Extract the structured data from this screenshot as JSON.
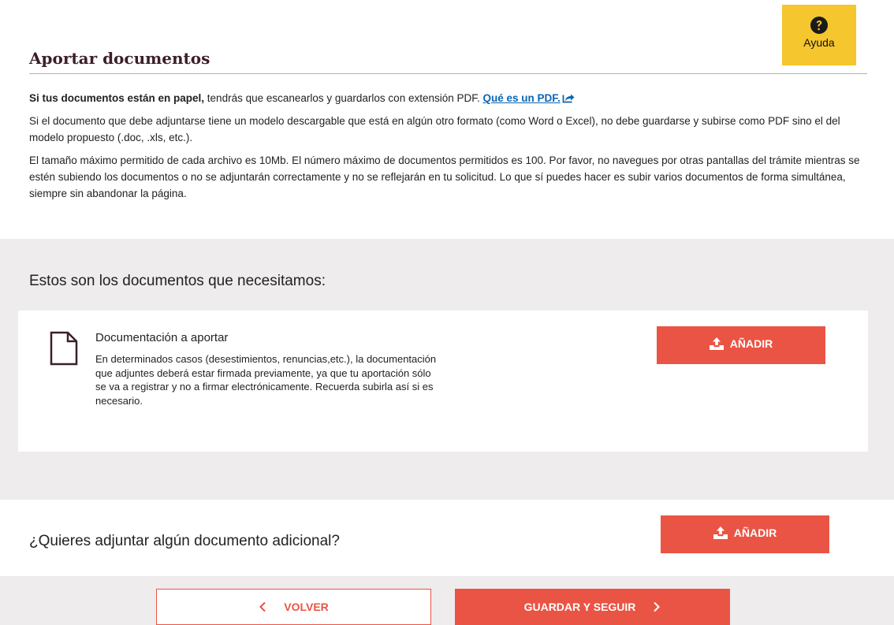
{
  "header": {
    "title": "Aportar documentos",
    "help_label": "Ayuda"
  },
  "intro": {
    "p1_strong": "Si tus documentos están en papel,",
    "p1_text": " tendrás que escanearlos y guardarlos con extensión PDF. ",
    "p1_link": "Qué es un PDF.",
    "p2": "Si el documento que debe adjuntarse tiene un modelo descargable que está en algún otro formato (como Word o Excel), no debe guardarse y subirse como PDF sino el del modelo propuesto (.doc, .xls, etc.).",
    "p3": "El tamaño máximo permitido de cada archivo es 10Mb. El número máximo de documentos permitidos es 100. Por favor, no navegues por otras pantallas del trámite mientras se estén subiendo los documentos o no se adjuntarán correctamente y no se reflejarán en tu solicitud. Lo que sí puedes hacer es subir varios documentos de forma simultánea, siempre sin abandonar la página."
  },
  "required_docs": {
    "heading": "Estos son los documentos que necesitamos:",
    "items": [
      {
        "title": "Documentación a aportar",
        "description": "En determinados casos (desestimientos, renuncias,etc.), la documentación que adjuntes deberá estar firmada previamente, ya que tu aportación sólo se va a registrar y no a firmar electrónicamente. Recuerda subirla así si es necesario.",
        "button_label": "AÑADIR"
      }
    ]
  },
  "additional": {
    "question": "¿Quieres adjuntar algún documento adicional?",
    "button_label": "AÑADIR"
  },
  "footer": {
    "back_label": "VOLVER",
    "next_label": "GUARDAR Y SEGUIR"
  },
  "colors": {
    "accent": "#ea5444",
    "help_bg": "#f5c62d",
    "title": "#3d1f26",
    "link": "#0b66b2",
    "panel_bg": "#eeecec"
  },
  "icons": [
    "question-circle-icon",
    "external-link-icon",
    "document-icon",
    "upload-icon",
    "chevron-left-icon",
    "chevron-right-icon"
  ]
}
